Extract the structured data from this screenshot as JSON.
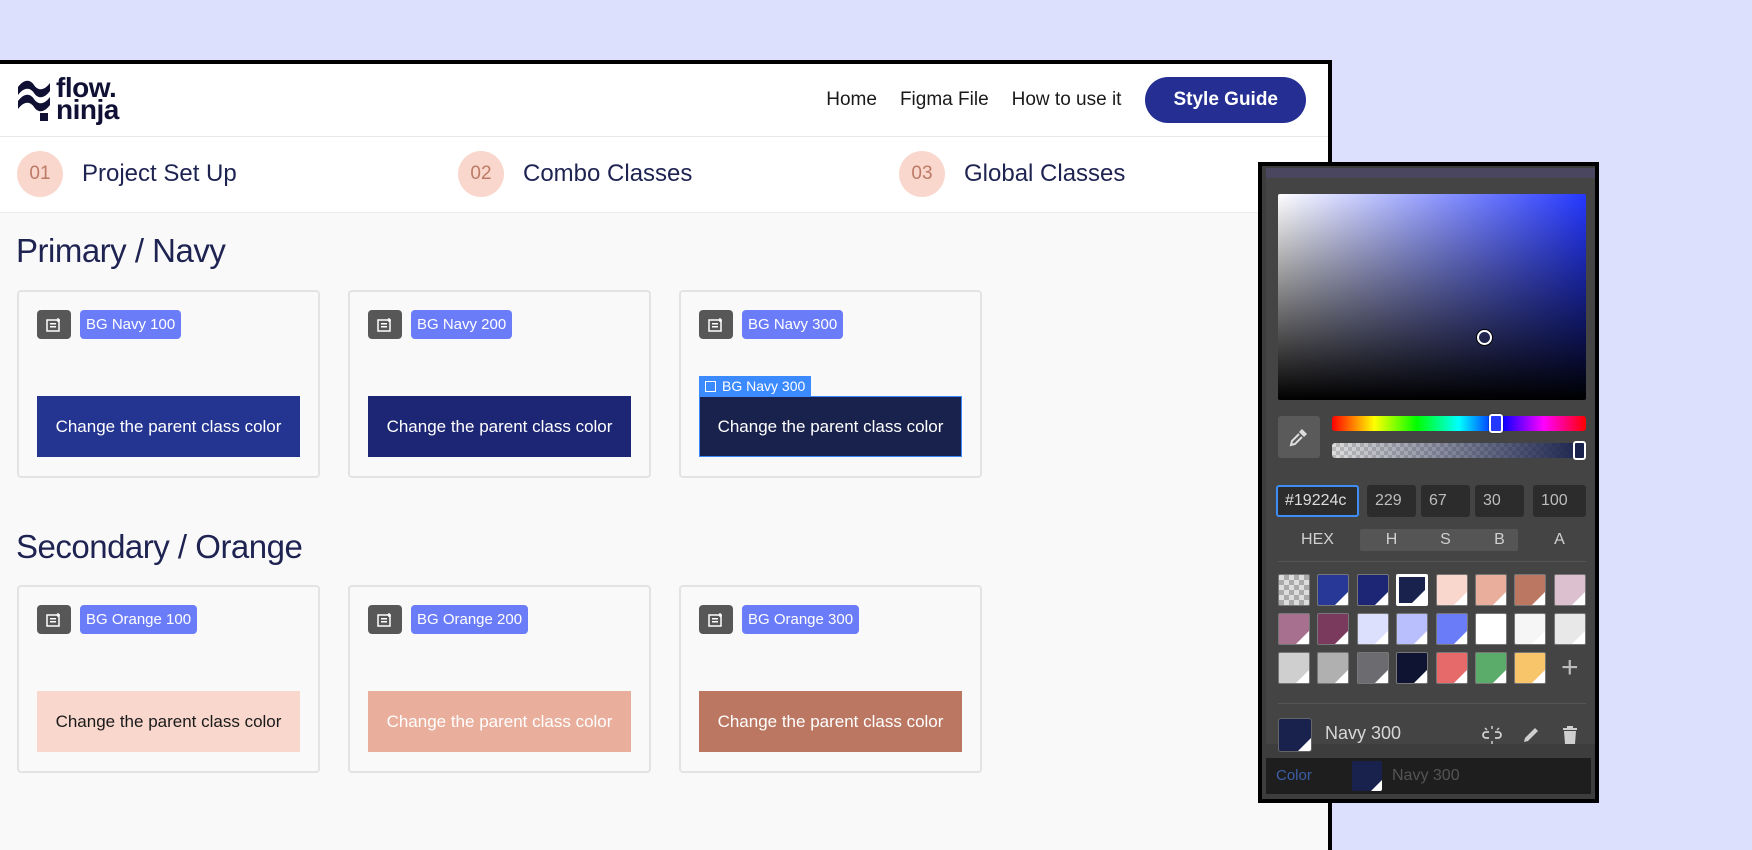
{
  "logo": {
    "line1": "flow.",
    "line2": "ninja"
  },
  "nav": {
    "links": [
      "Home",
      "Figma File",
      "How to use it"
    ],
    "cta": "Style Guide"
  },
  "steps": [
    {
      "num": "01",
      "title": "Project Set Up"
    },
    {
      "num": "02",
      "title": "Combo Classes"
    },
    {
      "num": "03",
      "title": "Global Classes"
    }
  ],
  "sections": [
    {
      "title": "Primary / Navy",
      "cards": [
        {
          "tag": "BG Navy 100",
          "text": "Change the parent class color",
          "bg": "#243491",
          "fg": "#ffffff"
        },
        {
          "tag": "BG Navy 200",
          "text": "Change the parent class color",
          "bg": "#1d2674",
          "fg": "#ffffff"
        },
        {
          "tag": "BG Navy 300",
          "text": "Change the parent class color",
          "bg": "#19224c",
          "fg": "#ffffff",
          "selected_label": "BG Navy 300"
        }
      ]
    },
    {
      "title": "Secondary / Orange",
      "cards": [
        {
          "tag": "BG Orange 100",
          "text": "Change the parent class color",
          "bg": "#f9d7cc",
          "fg": "#1a1a1a"
        },
        {
          "tag": "BG Orange 200",
          "text": "Change the parent class color",
          "bg": "#e9ae9c",
          "fg": "#ffffff"
        },
        {
          "tag": "BG Orange 300",
          "text": "Change the parent class color",
          "bg": "#bb7762",
          "fg": "#ffffff"
        }
      ]
    }
  ],
  "picker": {
    "hex": "#19224c",
    "h": "229",
    "s": "67",
    "b": "30",
    "a": "100",
    "labels": {
      "hex": "HEX",
      "h": "H",
      "s": "S",
      "b": "B",
      "a": "A"
    },
    "swatches": [
      [
        "checker",
        "#283896",
        "#1d2674",
        "#19224c",
        "#f9d7cc",
        "#e9ae9c",
        "#bb7762",
        "#dcc0d0"
      ],
      [
        "#a7708f",
        "#7a3a5e",
        "#dde0fd",
        "#b9bffc",
        "#6b7cf8",
        "#ffffff",
        "#f6f6f6",
        "#e8e8e8"
      ],
      [
        "#cfcfcf",
        "#b0b0b0",
        "#6c6c70",
        "#0f1433",
        "#e76a6a",
        "#5bab6a",
        "#f8c56a",
        "add"
      ]
    ],
    "selected_swatch": "#19224c",
    "current_name": "Navy 300",
    "property_label": "Color",
    "property_value": "Navy 300"
  }
}
